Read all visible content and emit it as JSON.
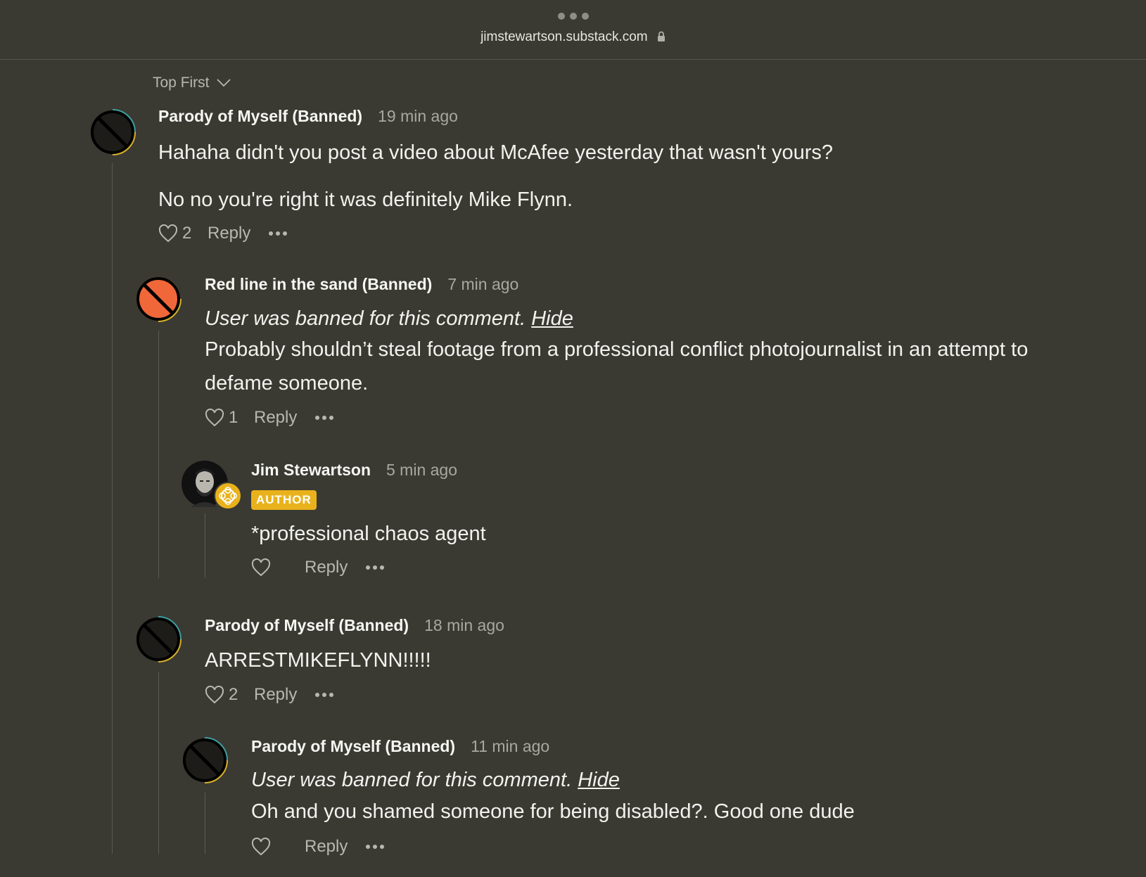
{
  "browser": {
    "url": "jimstewartson.substack.com"
  },
  "sort": {
    "label": "Top First"
  },
  "comments": [
    {
      "author": "Parody of Myself (Banned)",
      "time": "19 min ago",
      "paragraphs": [
        "Hahaha didn't you post a video about McAfee yesterday that wasn't yours?",
        "No no you're right it was definitely Mike Flynn."
      ],
      "likes": "2",
      "reply_label": "Reply"
    },
    {
      "author": "Red line in the sand (Banned)",
      "time": "7 min ago",
      "banned_notice": "User was banned for this comment.",
      "hide_label": "Hide",
      "text_line1": "Probably shouldn’t steal footage from a professional conflict photojournalist in an attempt to",
      "text_line2": "defame someone.",
      "likes": "1",
      "reply_label": "Reply"
    },
    {
      "author": "Jim Stewartson",
      "time": "5 min ago",
      "badge": "AUTHOR",
      "text": "*professional chaos agent",
      "likes": "",
      "reply_label": "Reply"
    },
    {
      "author": "Parody of Myself (Banned)",
      "time": "18 min ago",
      "text": "ARRESTMIKEFLYNN!!!!!",
      "likes": "2",
      "reply_label": "Reply"
    },
    {
      "author": "Parody of Myself (Banned)",
      "time": "11 min ago",
      "banned_notice": "User was banned for this comment.",
      "hide_label": "Hide",
      "text": "Oh and you shamed someone for being disabled?. Good one dude",
      "likes": "",
      "reply_label": "Reply"
    }
  ],
  "colors": {
    "background": "#3a3a33",
    "author_badge": "#e9b21c",
    "banned_avatar_orange": "#f0673a"
  },
  "icons": {
    "banned_avatar": "no-entry-icon",
    "like": "heart-icon",
    "more": "ellipsis-icon",
    "sort": "chevron-down-icon",
    "secure": "lock-icon"
  }
}
